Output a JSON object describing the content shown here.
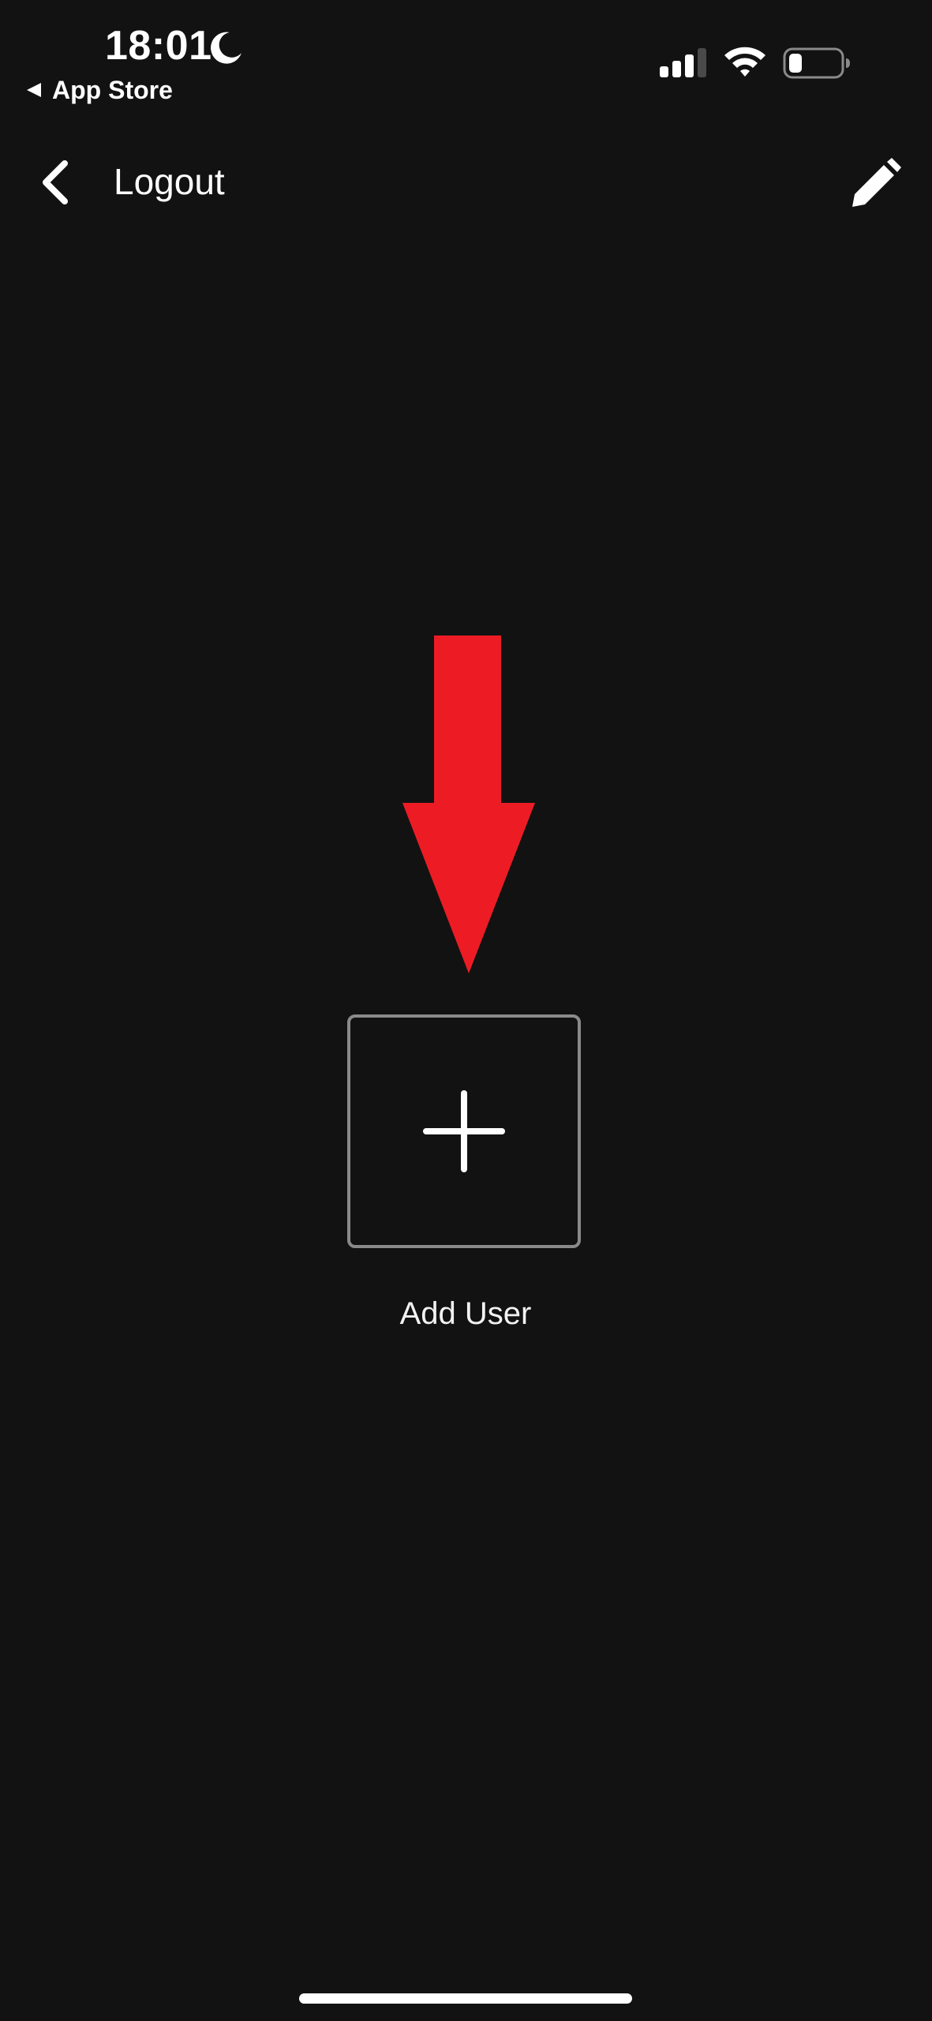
{
  "status_bar": {
    "time": "18:01",
    "back_app_label": "App Store",
    "signal_bars_filled": 3,
    "signal_bars_total": 4,
    "battery_level": 0.25
  },
  "nav": {
    "title": "Logout",
    "back_icon": "chevron-left-icon",
    "edit_icon": "pencil-icon"
  },
  "main": {
    "add_user_label": "Add User",
    "add_icon": "plus-icon"
  },
  "colors": {
    "background": "#121212",
    "text": "#ffffff",
    "tile_border": "#8a8a8a",
    "annotation_arrow": "#ed1c24"
  }
}
